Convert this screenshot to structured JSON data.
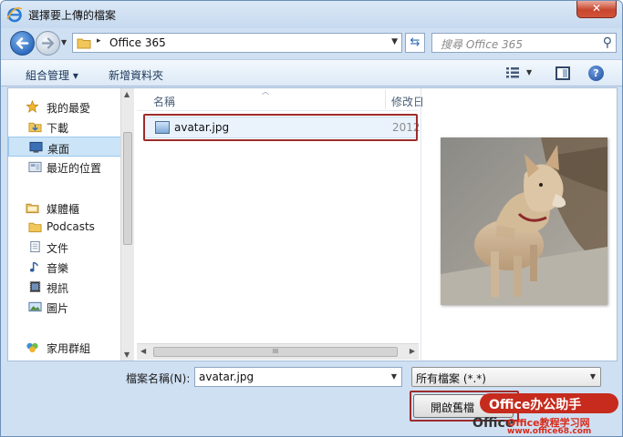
{
  "window": {
    "title": "選擇要上傳的檔案",
    "close_glyph": "✕"
  },
  "navigation": {
    "back_icon": "back-arrow-icon",
    "forward_icon": "forward-arrow-icon",
    "address_path": "Office 365",
    "address_separator": "▸",
    "search_placeholder": "搜尋 Office 365"
  },
  "toolbar": {
    "organize_label": "組合管理 ▾",
    "new_folder_label": "新增資料夾",
    "help_glyph": "?"
  },
  "sidebar": {
    "items": [
      {
        "label": "我的最愛",
        "icon": "star-icon",
        "type": "group"
      },
      {
        "label": "下載",
        "icon": "download-folder-icon",
        "type": "item"
      },
      {
        "label": "桌面",
        "icon": "desktop-icon",
        "type": "item",
        "selected": true
      },
      {
        "label": "最近的位置",
        "icon": "recent-places-icon",
        "type": "item"
      },
      {
        "label": "媒體櫃",
        "icon": "library-icon",
        "type": "group"
      },
      {
        "label": "Podcasts",
        "icon": "folder-icon",
        "type": "item"
      },
      {
        "label": "文件",
        "icon": "documents-icon",
        "type": "item"
      },
      {
        "label": "音樂",
        "icon": "music-icon",
        "type": "item"
      },
      {
        "label": "視訊",
        "icon": "video-icon",
        "type": "item"
      },
      {
        "label": "圖片",
        "icon": "pictures-icon",
        "type": "item"
      },
      {
        "label": "家用群組",
        "icon": "homegroup-icon",
        "type": "group"
      }
    ]
  },
  "file_list": {
    "columns": [
      "名稱",
      "修改日"
    ],
    "rows": [
      {
        "name": "avatar.jpg",
        "modified": "2012",
        "icon": "image-file-icon",
        "selected": true
      }
    ],
    "scroll_grip": "III"
  },
  "footer": {
    "filename_label": "檔案名稱(N):",
    "filename_value": "avatar.jpg",
    "filetype_value": "所有檔案 (*.*)",
    "open_button_label": "開啟舊檔"
  },
  "watermark": {
    "top": "Office办公助手",
    "office": "Office",
    "bottom": "Office教程学习网",
    "url": "www.office68.com"
  },
  "colors": {
    "highlight_box": "#9e2b2b",
    "selection": "#cce4f7",
    "title_bar": "#dbe8f6",
    "watermark_red": "#c62b1d"
  }
}
